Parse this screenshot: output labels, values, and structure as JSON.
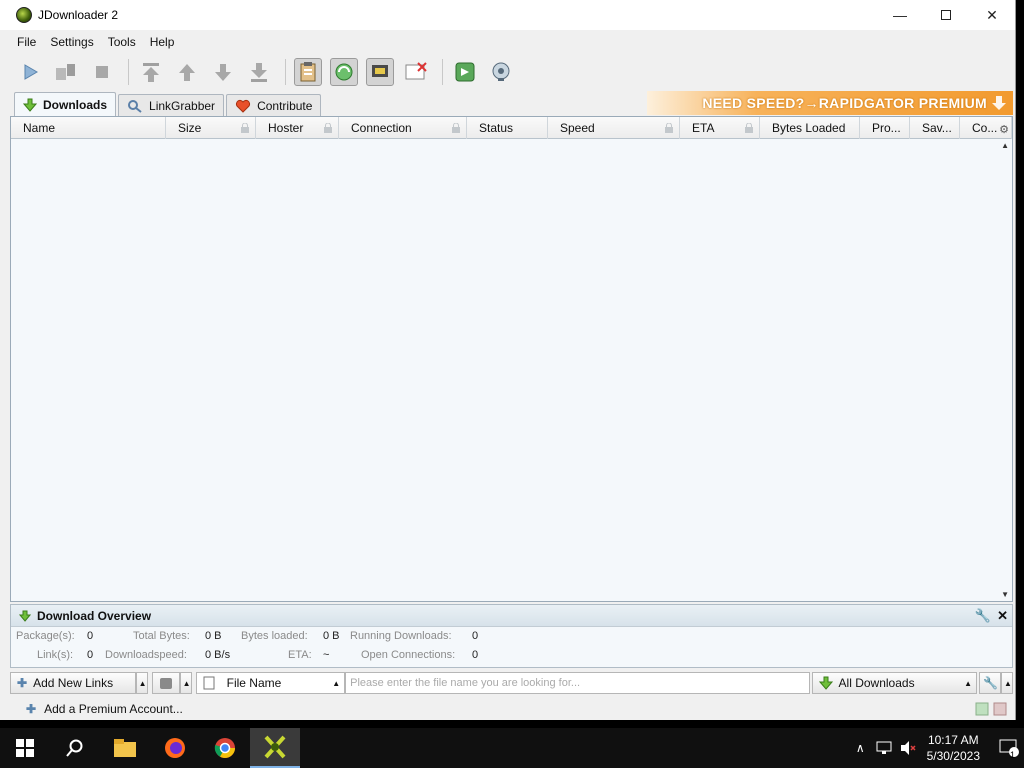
{
  "window": {
    "title": "JDownloader 2",
    "controls": {
      "minimize": "—",
      "close": "✕"
    }
  },
  "menu": {
    "items": [
      "File",
      "Settings",
      "Tools",
      "Help"
    ]
  },
  "toolbar": {
    "icons": [
      "play-icon",
      "pause-icon",
      "stop-icon",
      "move-top-icon",
      "move-up-icon",
      "move-down-icon",
      "move-bottom-icon",
      "clipboard-observer-icon",
      "auto-reconnect-icon",
      "premium-icon",
      "silent-mode-icon",
      "reconnect-icon",
      "update-icon"
    ]
  },
  "tabs": [
    {
      "label": "Downloads",
      "icon": "download-arrow-icon"
    },
    {
      "label": "LinkGrabber",
      "icon": "linkgrabber-icon"
    },
    {
      "label": "Contribute",
      "icon": "heart-icon"
    }
  ],
  "banner": {
    "text": "NEED SPEED?→RAPIDGATOR PREMIUM"
  },
  "table": {
    "columns": [
      {
        "label": "Name",
        "locked": false
      },
      {
        "label": "Size",
        "locked": true
      },
      {
        "label": "Hoster",
        "locked": true
      },
      {
        "label": "Connection",
        "locked": true
      },
      {
        "label": "Status",
        "locked": false
      },
      {
        "label": "Speed",
        "locked": true
      },
      {
        "label": "ETA",
        "locked": true
      },
      {
        "label": "Bytes Loaded",
        "locked": false
      },
      {
        "label": "Pro...",
        "locked": false
      },
      {
        "label": "Sav...",
        "locked": false
      },
      {
        "label": "Co...",
        "locked": false
      }
    ],
    "rows": []
  },
  "overview": {
    "title": "Download Overview",
    "packages_label": "Package(s):",
    "packages_value": "0",
    "links_label": "Link(s):",
    "links_value": "0",
    "total_bytes_label": "Total Bytes:",
    "total_bytes_value": "0 B",
    "downloadspeed_label": "Downloadspeed:",
    "downloadspeed_value": "0 B/s",
    "bytes_loaded_label": "Bytes loaded:",
    "bytes_loaded_value": "0 B",
    "eta_label": "ETA:",
    "eta_value": "~",
    "running_label": "Running Downloads:",
    "running_value": "0",
    "connections_label": "Open Connections:",
    "connections_value": "0"
  },
  "bottombar": {
    "add_links_label": "Add New Links",
    "search_field_label": "File Name",
    "search_placeholder": "Please enter the file name you are looking for...",
    "filter_label": "All Downloads"
  },
  "statusbar": {
    "add_account_label": "Add a Premium Account..."
  },
  "taskbar": {
    "apps": [
      "start-icon",
      "search-icon",
      "file-explorer-icon",
      "firefox-icon",
      "chrome-icon",
      "jdownloader-icon"
    ],
    "time": "10:17 AM",
    "date": "5/30/2023",
    "notification_count": "1"
  },
  "colors": {
    "accent": "#f29a2e",
    "table_bg": "#f4f8fb",
    "taskbar": "#101010"
  }
}
